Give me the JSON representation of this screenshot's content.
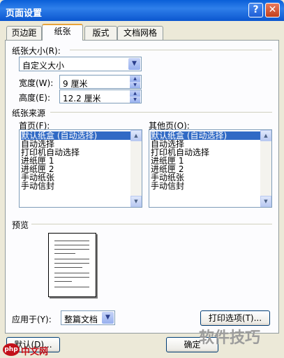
{
  "window": {
    "title": "页面设置",
    "help": "?",
    "close": "✕"
  },
  "tabs": [
    {
      "label": "页边距"
    },
    {
      "label": "纸张"
    },
    {
      "label": "版式"
    },
    {
      "label": "文档网格"
    }
  ],
  "paper_size": {
    "group_label": "纸张大小(R):",
    "selected": "自定义大小",
    "width_label": "宽度(W):",
    "width_value": "9 厘米",
    "height_label": "高度(E):",
    "height_value": "12.2 厘米"
  },
  "paper_source": {
    "group_label": "纸张来源",
    "first_page_label": "首页(F):",
    "other_pages_label": "其他页(O):",
    "items": [
      "默认纸盒 (自动选择)",
      "自动选择",
      "打印机自动选择",
      "进纸匣 1",
      "进纸匣 2",
      "手动纸张",
      "手动信封"
    ]
  },
  "preview": {
    "label": "预览"
  },
  "apply_to": {
    "label": "应用于(Y):",
    "selected": "整篇文档"
  },
  "buttons": {
    "print_options": "打印选项(T)...",
    "default": "默认(D)...",
    "ok": "确定"
  },
  "watermark": {
    "text": "软件技巧"
  },
  "logo": {
    "badge": "php",
    "text": "中文网"
  }
}
